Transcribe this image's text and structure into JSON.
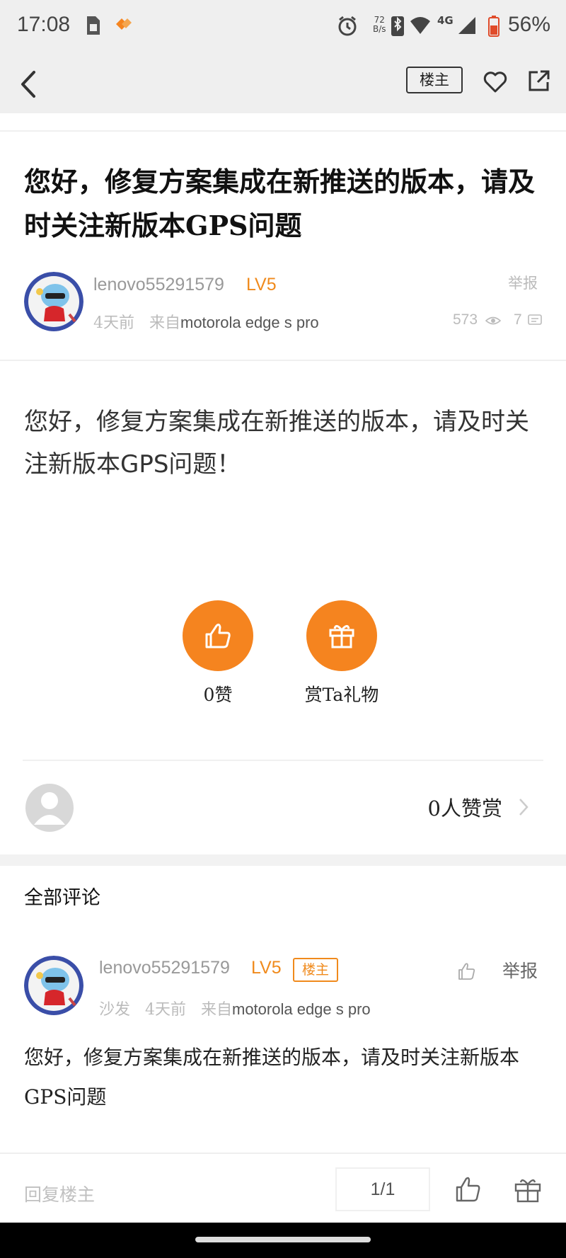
{
  "status_bar": {
    "time": "17:08",
    "net_speed_value": "72",
    "net_speed_unit": "B/s",
    "network": "4G",
    "battery": "56%"
  },
  "nav": {
    "back_icon": "chevron-left-icon",
    "owner_only_label": "楼主",
    "favorite_icon": "heart-icon",
    "share_icon": "share-icon"
  },
  "post": {
    "title": "您好，修复方案集成在新推送的版本，请及时关注新版本GPS问题",
    "author": "lenovo55291579",
    "level": "LV5",
    "time_ago": "4天前",
    "from_label": "来自",
    "device": "motorola edge s pro",
    "report_label": "举报",
    "views": "573",
    "comments": "7",
    "body": "您好，修复方案集成在新推送的版本，请及时关注新版本GPS问题！"
  },
  "actions": {
    "like_label": "0赞",
    "gift_label": "赏Ta礼物"
  },
  "tips": {
    "count_label": "0人赞赏"
  },
  "comments": {
    "section_title": "全部评论",
    "items": [
      {
        "author": "lenovo55291579",
        "level": "LV5",
        "owner_tag": "楼主",
        "floor": "沙发",
        "time_ago": "4天前",
        "from_label": "来自",
        "device": "motorola edge s pro",
        "report_label": "举报",
        "body": "您好，修复方案集成在新推送的版本，请及时关注新版本GPS问题"
      }
    ]
  },
  "bottom_bar": {
    "reply_placeholder": "回复楼主",
    "page_indicator": "1/1"
  },
  "colors": {
    "accent": "#f5841f",
    "level": "#f08a1c",
    "muted": "#bbbbbb"
  }
}
